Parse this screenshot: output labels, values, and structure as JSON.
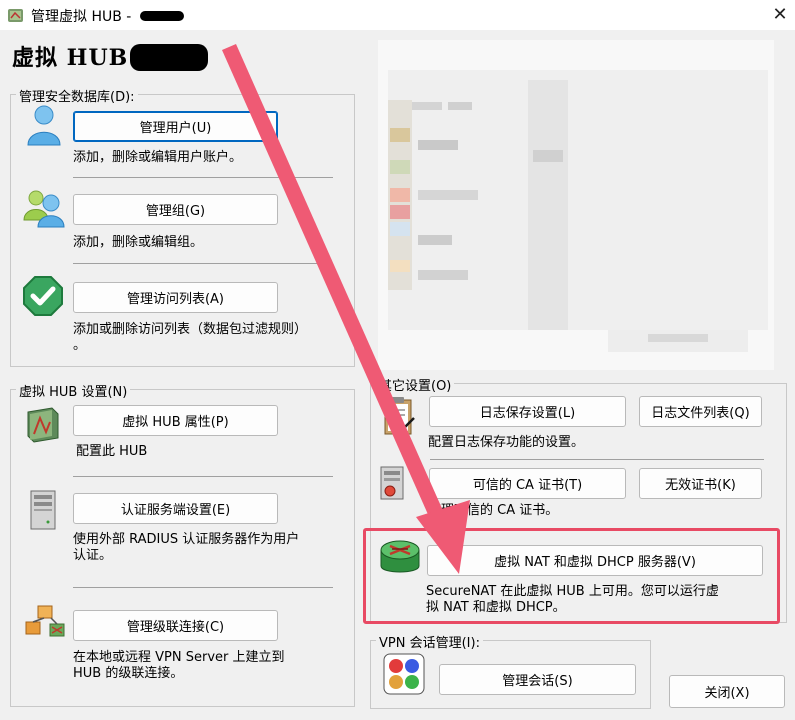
{
  "window": {
    "title": "管理虚拟 HUB -",
    "hub_title": "虚拟  HUB",
    "close_symbol": "✕"
  },
  "security_db": {
    "legend": "管理安全数据库(D):",
    "manage_users": {
      "label": "管理用户(U)",
      "desc": "添加，删除或编辑用户账户。"
    },
    "manage_groups": {
      "label": "管理组(G)",
      "desc": "添加，删除或编辑组。"
    },
    "manage_access_list": {
      "label": "管理访问列表(A)",
      "desc_line1": "添加或删除访问列表（数据包过滤规则）",
      "desc_line2": "。"
    }
  },
  "hub_settings": {
    "legend": "虚拟 HUB 设置(N)",
    "properties": {
      "label": "虚拟 HUB 属性(P)",
      "desc": "配置此 HUB"
    },
    "auth_server": {
      "label": "认证服务端设置(E)",
      "desc_line1": "使用外部 RADIUS 认证服务器作为用户",
      "desc_line2": "认证。"
    },
    "cascade": {
      "label": "管理级联连接(C)",
      "desc_line1": "在本地或远程 VPN Server 上建立到",
      "desc_line2": "HUB 的级联连接。"
    }
  },
  "other_settings": {
    "legend": "其它设置(O)",
    "log_save": {
      "label": "日志保存设置(L)",
      "desc": "配置日志保存功能的设置。"
    },
    "log_files": {
      "label": "日志文件列表(Q)"
    },
    "trusted_ca": {
      "label": "可信的 CA 证书(T)",
      "desc": "管理可信的 CA 证书。"
    },
    "invalid_cert": {
      "label": "无效证书(K)"
    },
    "securenat": {
      "label": "虚拟 NAT 和虚拟 DHCP 服务器(V)",
      "desc_line1": "SecureNAT 在此虚拟 HUB 上可用。您可以运行虚",
      "desc_line2": "拟 NAT 和虚拟 DHCP。"
    }
  },
  "vpn_sessions": {
    "legend": "VPN 会话管理(I):",
    "manage_sessions": {
      "label": "管理会话(S)"
    }
  },
  "close_button": {
    "label": "关闭(X)"
  },
  "colors": {
    "highlight_border": "#e84a64",
    "arrow": "#ef5a74",
    "focus": "#0067c0"
  },
  "icons": [
    "hub-app-icon",
    "user-icon",
    "group-icon",
    "checkmark-shield-icon",
    "hub-properties-icon",
    "server-icon",
    "cascade-icon",
    "clipboard-icon",
    "certificate-server-icon",
    "router-icon",
    "sessions-icon"
  ]
}
